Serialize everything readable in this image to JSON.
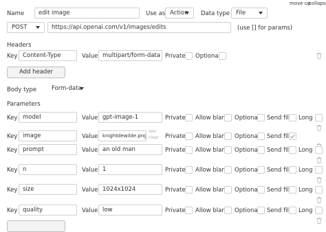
{
  "top_links": {
    "move_up": "move up",
    "collapse": "collapse"
  },
  "call": {
    "name_label": "Name",
    "name_value": "edit image",
    "use_as_label": "Use as",
    "use_as_value": "Action",
    "data_type_label": "Data type",
    "data_type_value": "File",
    "method": "POST",
    "url": "https://api.openai.com/v1/images/edits",
    "url_hint": "(use [] for params)"
  },
  "headers": {
    "section_label": "Headers",
    "key_label": "Key",
    "key_value": "Content-Type",
    "value_label": "Value",
    "value_value": "multipart/form-data",
    "private_label": "Private",
    "optional_label": "Optional",
    "add_button": "Add header"
  },
  "body": {
    "type_label": "Body type",
    "type_value": "Form-data",
    "params_label": "Parameters"
  },
  "param_labels": {
    "key": "Key",
    "value": "Value",
    "private": "Private",
    "allow_blank": "Allow blank",
    "optional": "Optional",
    "send_file": "Send file",
    "long": "Long"
  },
  "params": [
    {
      "key": "model",
      "value": "gpt-image-1",
      "send_file": false
    },
    {
      "key": "image",
      "value": "knightdewilde.png",
      "send_file": true,
      "side_see": "see",
      "side_clear": "clear"
    },
    {
      "key": "prompt",
      "value": "an old man",
      "send_file": false
    },
    {
      "key": "n",
      "value": "1",
      "send_file": false
    },
    {
      "key": "size",
      "value": "1024x1024",
      "send_file": false
    },
    {
      "key": "quality",
      "value": "low",
      "send_file": false
    }
  ]
}
